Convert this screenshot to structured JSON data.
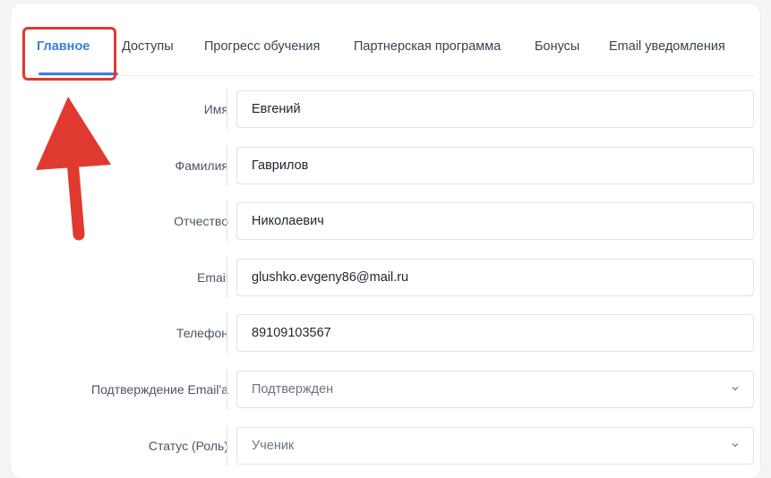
{
  "tabs": [
    {
      "label": "Главное",
      "active": true
    },
    {
      "label": "Доступы",
      "active": false
    },
    {
      "label": "Прогресс обучения",
      "active": false
    },
    {
      "label": "Партнерская программа",
      "active": false
    },
    {
      "label": "Бонусы",
      "active": false
    },
    {
      "label": "Email уведомления",
      "active": false
    }
  ],
  "form": {
    "first_name": {
      "label": "Имя",
      "value": "Евгений"
    },
    "last_name": {
      "label": "Фамилия",
      "value": "Гаврилов"
    },
    "patronymic": {
      "label": "Отчество",
      "value": "Николаевич"
    },
    "email": {
      "label": "Email",
      "value": "glushko.evgeny86@mail.ru"
    },
    "phone": {
      "label": "Телефон",
      "value": "89109103567"
    },
    "email_confirm": {
      "label": "Подтверждение Email'a",
      "value": "Подтвержден",
      "icon": "chevron-down-icon"
    },
    "status": {
      "label": "Статус (Роль)",
      "value": "Ученик",
      "icon": "chevron-down-icon"
    }
  },
  "annotation": {
    "color": "#e0392f",
    "icon": "red-arrow-icon"
  },
  "colors": {
    "accent": "#3b7ddd"
  }
}
